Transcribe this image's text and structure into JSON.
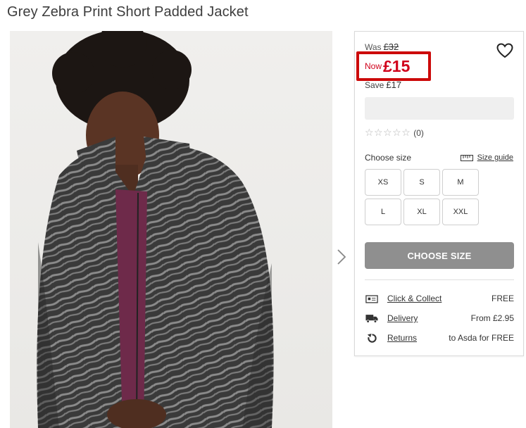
{
  "product": {
    "title": "Grey Zebra Print Short Padded Jacket"
  },
  "price": {
    "was_label": "Was",
    "was_value": "£32",
    "now_label": "Now",
    "now_value": "£15",
    "save_label": "Save",
    "save_value": "£17",
    "highlight_color": "#cc0a0a",
    "now_color": "#d0021b"
  },
  "rating": {
    "stars": "☆☆☆☆☆",
    "count": "(0)"
  },
  "sizes": {
    "label": "Choose size",
    "guide_label": "Size guide",
    "options": [
      "XS",
      "S",
      "M",
      "L",
      "XL",
      "XXL"
    ]
  },
  "cta": {
    "label": "CHOOSE SIZE",
    "color": "#8f8f8f"
  },
  "fulfilment": [
    {
      "icon": "store-icon",
      "label": "Click & Collect",
      "value": "FREE"
    },
    {
      "icon": "truck-icon",
      "label": "Delivery",
      "value": "From £2.95"
    },
    {
      "icon": "returns-icon",
      "label": "Returns",
      "value": "to Asda for FREE"
    }
  ],
  "icons": {
    "wishlist": "heart-icon",
    "gallery_next": "chevron-right-icon",
    "size_guide": "ruler-icon"
  }
}
